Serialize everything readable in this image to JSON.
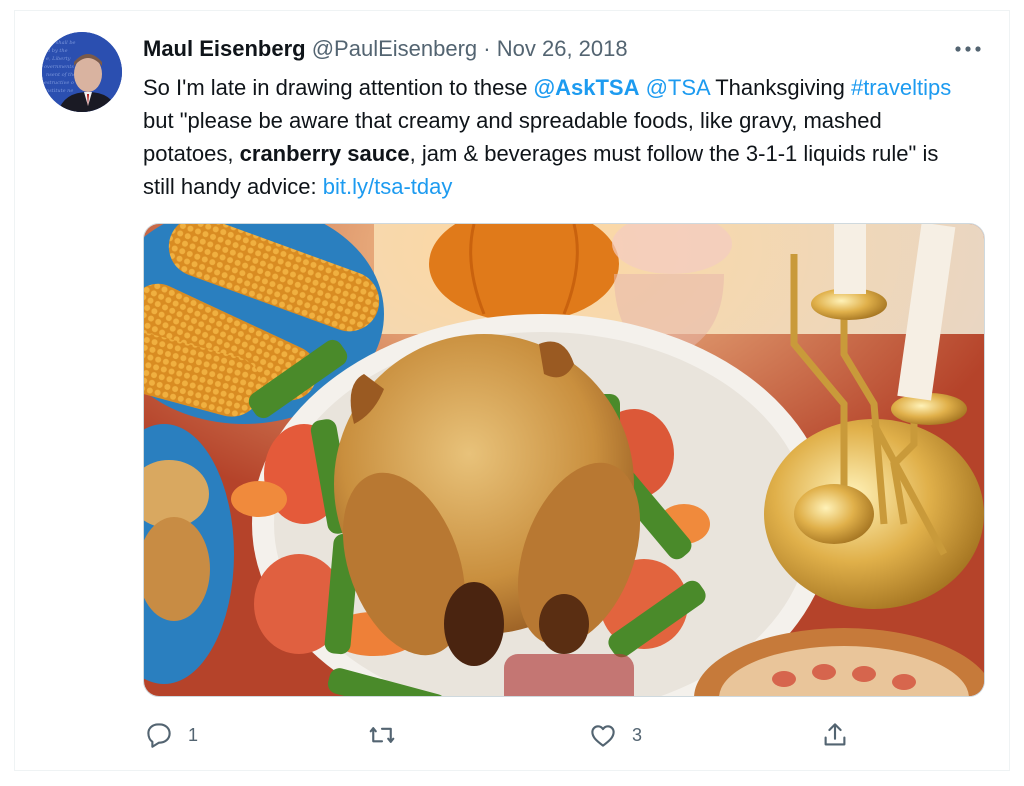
{
  "tweet": {
    "author_name": "Maul Eisenberg",
    "handle": "@PaulEisenberg",
    "separator": "·",
    "date": "Nov 26, 2018",
    "text": {
      "t1": "So I'm late in drawing attention to these ",
      "mention1": "@AskTSA",
      "t2": " ",
      "mention2": "@TSA",
      "t3": " Thanksgiving ",
      "hashtag": "#traveltips",
      "t4": " but \"please be aware that creamy and spreadable foods, like gravy, mashed potatoes, ",
      "bold": "cranberry sauce",
      "t5": ", jam & beverages must follow the 3-1-1 liquids rule\" is still handy advice: ",
      "link": "bit.ly/tsa-tday"
    },
    "image_alt": "Thanksgiving table with roast turkey, corn, pumpkin, candles and pie",
    "actions": {
      "reply_count": "1",
      "retweet_count": "",
      "like_count": "3"
    }
  },
  "icons": {
    "more": "more-horizontal-icon",
    "reply": "reply-icon",
    "retweet": "retweet-icon",
    "like": "heart-icon",
    "share": "share-icon"
  },
  "colors": {
    "link": "#1d9bf0",
    "text": "#0f1419",
    "secondary": "#536471",
    "border": "#eff3f4"
  }
}
